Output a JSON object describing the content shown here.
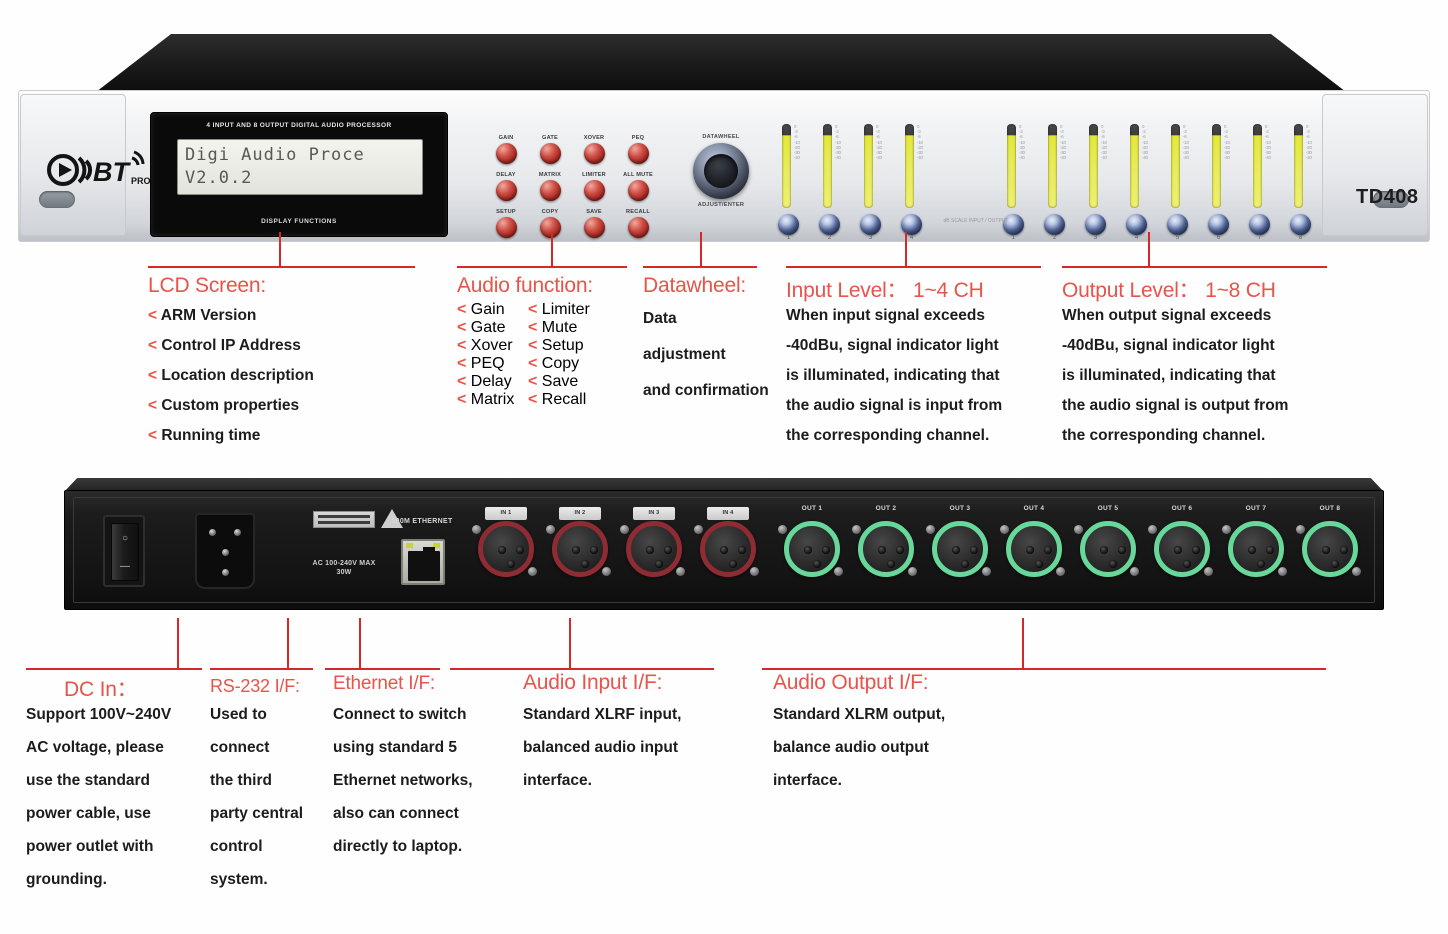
{
  "device": {
    "brand_logo": "OBT PRO",
    "model": "TD408",
    "lcd": {
      "caption_top": "4 INPUT AND 8 OUTPUT DIGITAL AUDIO PROCESSOR",
      "caption_bottom": "DISPLAY FUNCTIONS",
      "line1": "Digi Audio Proce",
      "line2": "V2.0.2"
    },
    "buttons": [
      "GAIN",
      "GATE",
      "XOVER",
      "PEQ",
      "DELAY",
      "MATRIX",
      "LIMITER",
      "ALL MUTE",
      "SETUP",
      "COPY",
      "SAVE",
      "RECALL"
    ],
    "datawheel": {
      "label_top": "DATAWHEEL",
      "label_bottom": "ADJUST/ENTER"
    },
    "input_meters": {
      "count": 4,
      "numbers": [
        "1",
        "2",
        "3",
        "4"
      ],
      "scale": "0 -3 -6 -10 -20 -30 -40"
    },
    "output_meters": {
      "count": 8,
      "numbers": [
        "1",
        "2",
        "3",
        "4",
        "5",
        "6",
        "7",
        "8"
      ],
      "scale": "0 -3 -6 -10 -20 -30 -40"
    },
    "mid_note": "dB SCALE  INPUT / OUTPUT",
    "rear": {
      "power_switch": {
        "on_symbol": "—",
        "off_symbol": "○"
      },
      "ac_label": "AC 100-240V MAX 30W",
      "ethernet_label": "100M ETHERNET",
      "inputs": [
        {
          "tag": "IN 1"
        },
        {
          "tag": "IN 2"
        },
        {
          "tag": "IN 3"
        },
        {
          "tag": "IN 4"
        }
      ],
      "outputs": [
        {
          "tag": "OUT 1"
        },
        {
          "tag": "OUT 2"
        },
        {
          "tag": "OUT 3"
        },
        {
          "tag": "OUT 4"
        },
        {
          "tag": "OUT 5"
        },
        {
          "tag": "OUT 6"
        },
        {
          "tag": "OUT 7"
        },
        {
          "tag": "OUT 8"
        }
      ]
    }
  },
  "annotations": {
    "lcd_screen": {
      "title": "LCD Screen:",
      "items": [
        "ARM Version",
        "Control IP Address",
        "Location description",
        "Custom properties",
        "Running time"
      ]
    },
    "audio_function": {
      "title": "Audio function:",
      "col_left": [
        "Gain",
        "Gate",
        "Xover",
        "PEQ",
        "Delay",
        "Matrix"
      ],
      "col_right": [
        "Limiter",
        "Mute",
        "Setup",
        "Copy",
        "Save",
        "Recall"
      ]
    },
    "datawheel": {
      "title": "Datawheel:",
      "lines": [
        "Data",
        "adjustment",
        "and confirmation"
      ]
    },
    "input_level": {
      "title": "Input Level： 1~4 CH",
      "lines": [
        "When input signal exceeds",
        "-40dBu, signal indicator light",
        "is illuminated, indicating that",
        "the audio signal is input from",
        "the corresponding channel."
      ]
    },
    "output_level": {
      "title": "Output Level： 1~8 CH",
      "lines": [
        "When output signal exceeds",
        "-40dBu, signal indicator light",
        "is illuminated, indicating that",
        "the audio signal is output from",
        "the corresponding channel."
      ]
    },
    "dc_in": {
      "title": "DC In：",
      "lines": [
        "Support 100V~240V",
        "AC voltage, please",
        "use the standard",
        "power cable, use",
        "power outlet with",
        "grounding."
      ]
    },
    "rs232": {
      "title": "RS-232 I/F:",
      "lines": [
        "Used to",
        "connect",
        "the third",
        "party central",
        "control",
        "system."
      ]
    },
    "ethernet": {
      "title": "Ethernet I/F:",
      "lines": [
        "Connect to switch",
        "using standard 5",
        "Ethernet networks,",
        "also can connect",
        "directly to laptop."
      ]
    },
    "audio_input": {
      "title": "Audio Input I/F:",
      "lines": [
        "Standard XLRF input,",
        "balanced audio input",
        "interface."
      ]
    },
    "audio_output": {
      "title": "Audio Output I/F:",
      "lines": [
        "Standard XLRM output,",
        "balance audio output",
        "interface."
      ]
    }
  },
  "colors": {
    "accent_red": "#d62828",
    "title_red": "#e8544a",
    "meter_yellow": "#e3e83a",
    "xlr_input_ring": "#8e2b33",
    "xlr_output_ring": "#68d79a",
    "body_text": "#1c1c1c"
  }
}
